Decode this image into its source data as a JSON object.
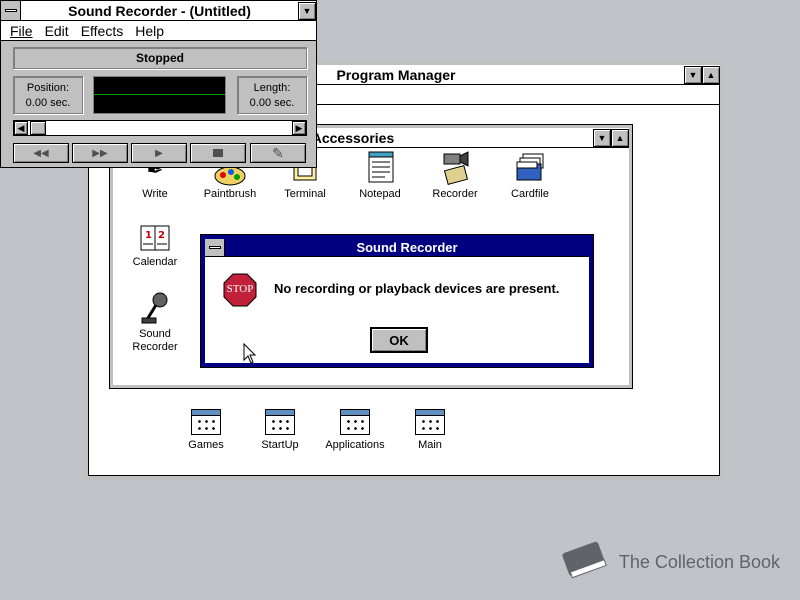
{
  "sound_recorder": {
    "title": "Sound Recorder - (Untitled)",
    "menu": [
      "File",
      "Edit",
      "Effects",
      "Help"
    ],
    "status": "Stopped",
    "position_label": "Position:",
    "position_value": "0.00 sec.",
    "length_label": "Length:",
    "length_value": "0.00 sec.",
    "buttons": [
      "rewind",
      "fast-forward",
      "play",
      "stop",
      "record"
    ]
  },
  "program_manager": {
    "title": "Program Manager",
    "groups": [
      "Games",
      "StartUp",
      "Applications",
      "Main"
    ]
  },
  "accessories": {
    "title": "Accessories",
    "items": [
      "Write",
      "Paintbrush",
      "Terminal",
      "Notepad",
      "Recorder",
      "Cardfile",
      "Calendar",
      "Sound\nRecorder"
    ]
  },
  "dialog": {
    "title": "Sound Recorder",
    "stop_label": "STOP",
    "message": "No recording or playback devices are present.",
    "ok_label": "OK"
  },
  "watermark": "The Collection Book",
  "colors": {
    "desktop": "#c0c4c8",
    "active_title": "#000080",
    "face": "#c0c0c0",
    "scope_line": "#00a000",
    "stop_sign": "#c0203a"
  }
}
